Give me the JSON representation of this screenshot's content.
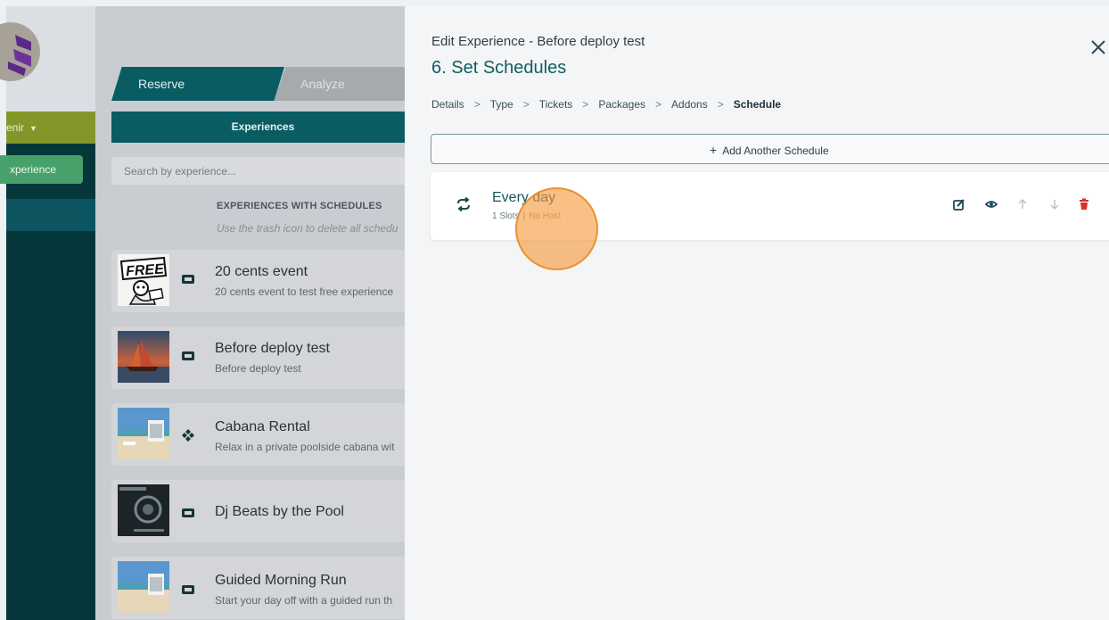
{
  "sidebar": {
    "user_label": "enir",
    "create_button": "xperience"
  },
  "tabs": {
    "reserve": "Reserve",
    "analyze": "Analyze"
  },
  "list": {
    "experiences_label": "Experiences",
    "search_placeholder": "Search by experience...",
    "section_title": "EXPERIENCES WITH SCHEDULES",
    "section_hint": "Use the trash icon to delete all schedu",
    "items": [
      {
        "title": "20 cents event",
        "desc": "20 cents event to test free experience",
        "type_icon": "ticket-icon",
        "thumb": "free-stamp"
      },
      {
        "title": "Before deploy test",
        "desc": "Before deploy test",
        "type_icon": "ticket-icon",
        "thumb": "sailboat-sunset"
      },
      {
        "title": "Cabana Rental",
        "desc": "Relax in a private poolside cabana wit",
        "type_icon": "diamond-icon",
        "thumb": "beach-cabana"
      },
      {
        "title": "Dj Beats by the Pool",
        "desc": "",
        "type_icon": "ticket-icon",
        "thumb": "soundtrack-cover"
      },
      {
        "title": "Guided Morning Run",
        "desc": "Start your day off with a guided run th",
        "type_icon": "ticket-icon",
        "thumb": "beach-cabana"
      }
    ]
  },
  "editor": {
    "heading": "Edit Experience - Before deploy test",
    "step_title": "6. Set Schedules",
    "breadcrumbs": [
      "Details",
      "Type",
      "Tickets",
      "Packages",
      "Addons",
      "Schedule"
    ],
    "add_schedule": "Add Another Schedule",
    "schedule": {
      "name": "Every day",
      "slots": "1 Slots",
      "host": "No Host",
      "actions": [
        "edit-icon",
        "eye-icon",
        "arrow-up-icon",
        "arrow-down-icon",
        "trash-icon"
      ]
    }
  },
  "colors": {
    "primary": "#0a5c63",
    "sidebar": "#04363a",
    "accent_green": "#47a16b",
    "olive": "#83962a",
    "delete_red": "#d9302c"
  }
}
